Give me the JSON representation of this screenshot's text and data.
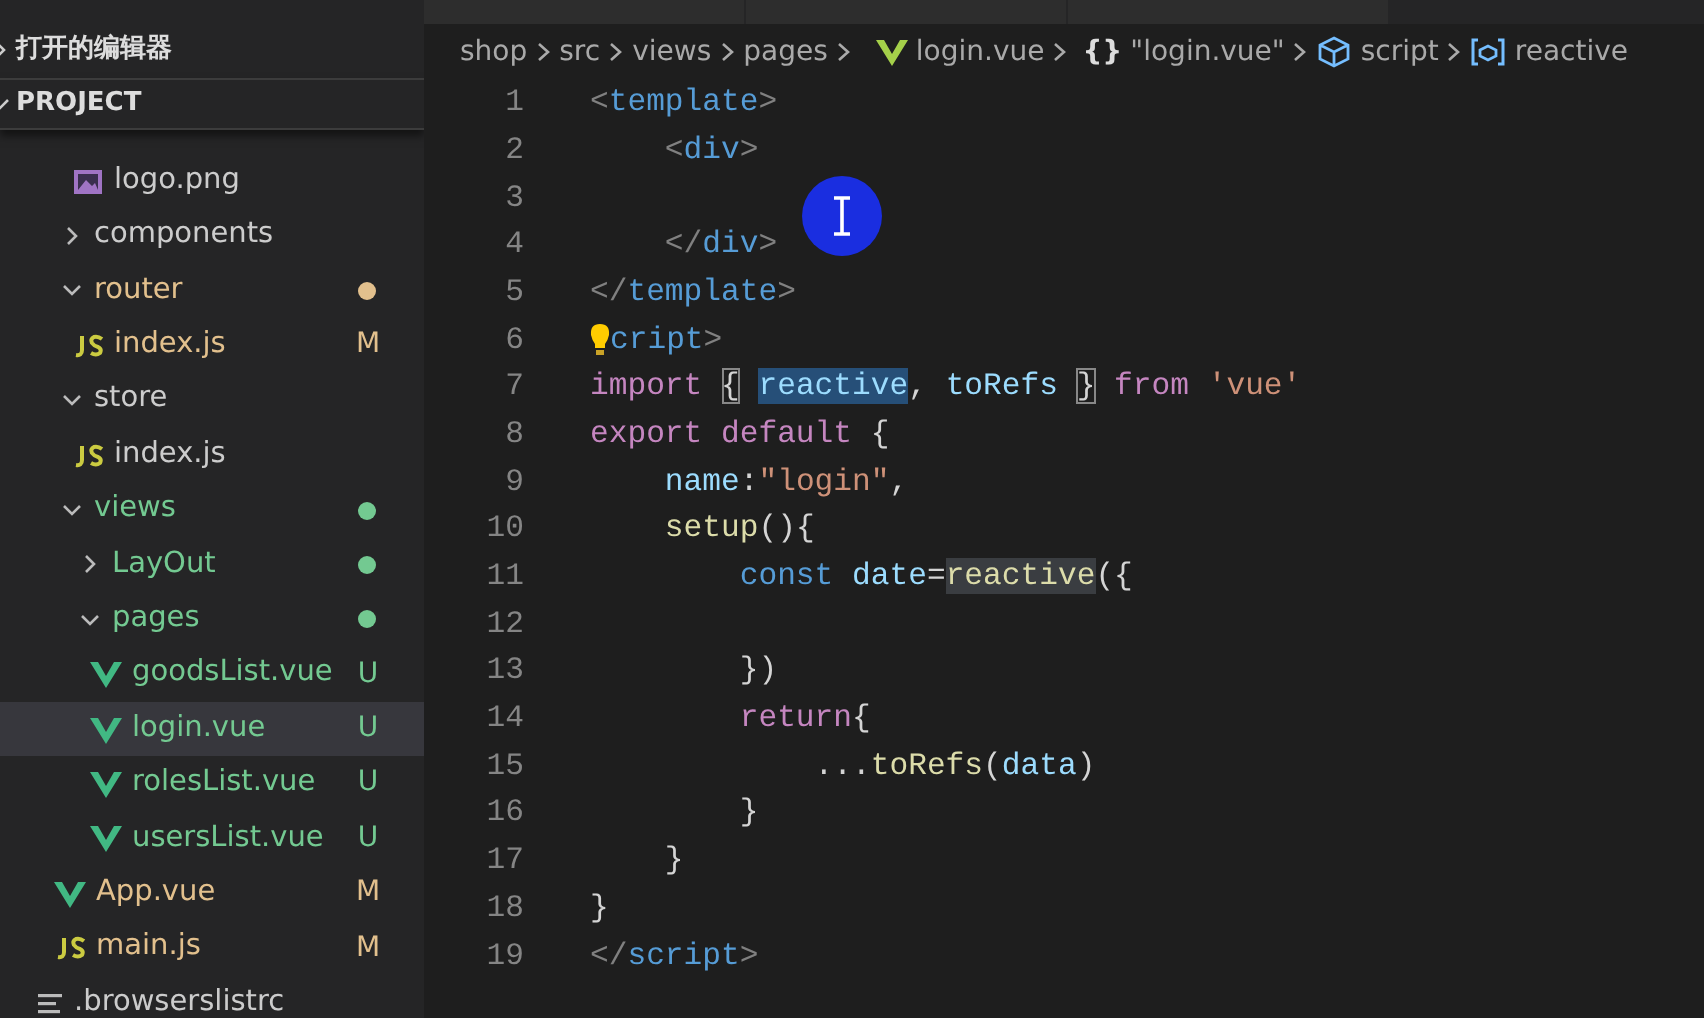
{
  "sidebar": {
    "sections": [
      {
        "title": "打开的编辑器",
        "expanded": false
      },
      {
        "title": "PROJECT",
        "expanded": true
      }
    ],
    "tree": [
      {
        "children": [
          {
            "children": [
              {
                "kind": "image",
                "name": "logo.png",
                "selected": false
              }
            ]
          },
          {
            "kind": "folder",
            "name": "components",
            "expanded": false,
            "selected": false
          },
          {
            "kind": "folder",
            "name": "router",
            "expanded": true,
            "color": "#e2c08d",
            "selected": false,
            "children": [
              {
                "kind": "js",
                "name": "index.js",
                "color": "#e2c08d",
                "status": "M",
                "selected": false
              }
            ]
          },
          {
            "kind": "folder",
            "name": "store",
            "expanded": true,
            "selected": false,
            "children": [
              {
                "kind": "js",
                "name": "index.js",
                "selected": false
              }
            ]
          },
          {
            "kind": "folder",
            "name": "views",
            "expanded": true,
            "color": "#73c991",
            "selected": false,
            "children": [
              {
                "kind": "folder",
                "name": "LayOut",
                "expanded": false,
                "color": "#73c991",
                "selected": false
              },
              {
                "kind": "folder",
                "name": "pages",
                "expanded": true,
                "color": "#73c991",
                "selected": false,
                "children": [
                  {
                    "kind": "vue",
                    "name": "goodsList.vue",
                    "color": "#73c991",
                    "status": "U",
                    "selected": false
                  },
                  {
                    "kind": "vue",
                    "name": "login.vue",
                    "color": "#73c991",
                    "status": "U",
                    "selected": true
                  },
                  {
                    "kind": "vue",
                    "name": "rolesList.vue",
                    "color": "#73c991",
                    "status": "U",
                    "selected": false
                  },
                  {
                    "kind": "vue",
                    "name": "usersList.vue",
                    "color": "#73c991",
                    "status": "U",
                    "selected": false
                  }
                ]
              }
            ]
          },
          {
            "kind": "vue",
            "name": "App.vue",
            "color": "#e2c08d",
            "status": "M",
            "selected": false
          },
          {
            "kind": "js",
            "name": "main.js",
            "color": "#e2c08d",
            "status": "M",
            "selected": false
          }
        ]
      },
      {
        "kind": "text",
        "name": ".browserslistrc",
        "selected": false
      }
    ]
  },
  "breadcrumbs": [
    {
      "kind": "folder",
      "label": "shop"
    },
    {
      "kind": "folder",
      "label": "src"
    },
    {
      "kind": "folder",
      "label": "views"
    },
    {
      "kind": "folder",
      "label": "pages"
    },
    {
      "kind": "vue",
      "label": "login.vue"
    },
    {
      "kind": "object",
      "glyph": "{}",
      "label": "\"login.vue\""
    },
    {
      "kind": "module",
      "label": "script"
    },
    {
      "kind": "variable",
      "label": "reactive"
    }
  ],
  "editor": {
    "pointer_highlight": true,
    "lines": [
      {
        "number": "1",
        "tokens": [
          {
            "text": "<",
            "kind": "punct"
          },
          {
            "text": "template",
            "kind": "tag"
          },
          {
            "text": ">",
            "kind": "punct"
          }
        ]
      },
      {
        "number": "2",
        "tokens": [
          {
            "text": "    <",
            "kind": "punct"
          },
          {
            "text": "div",
            "kind": "tag"
          },
          {
            "text": ">",
            "kind": "punct"
          }
        ]
      },
      {
        "number": "3"
      },
      {
        "number": "4",
        "tokens": [
          {
            "text": "    </",
            "kind": "punct"
          },
          {
            "text": "div",
            "kind": "tag"
          },
          {
            "text": ">",
            "kind": "punct"
          }
        ]
      },
      {
        "number": "5",
        "tokens": [
          {
            "text": "</",
            "kind": "punct"
          },
          {
            "text": "template",
            "kind": "tag"
          },
          {
            "text": ">",
            "kind": "punct"
          }
        ]
      },
      {
        "number": "6",
        "lightbulb": true,
        "tokens": [
          {
            "text": "cript",
            "kind": "tag"
          },
          {
            "text": ">",
            "kind": "punct"
          }
        ]
      },
      {
        "number": "7",
        "tokens": [
          {
            "text": "import ",
            "kind": "keyword"
          },
          {
            "text": "{",
            "kind": "plain",
            "matched": true
          },
          {
            "text": "reactive",
            "kind": "variable",
            "selected": true,
            "spaced": true
          },
          {
            "text": ", ",
            "kind": "plain"
          },
          {
            "text": "toRefs ",
            "kind": "variable"
          },
          {
            "text": "}",
            "kind": "plain",
            "matched": true
          },
          {
            "text": " from ",
            "kind": "keyword"
          },
          {
            "text": "'vue'",
            "kind": "string"
          }
        ]
      },
      {
        "number": "8",
        "tokens": [
          {
            "text": "export default",
            "kind": "keyword"
          },
          {
            "text": " {",
            "kind": "plain"
          }
        ]
      },
      {
        "number": "9",
        "tokens": [
          {
            "text": "    name",
            "kind": "variable"
          },
          {
            "text": ":",
            "kind": "plain"
          },
          {
            "text": "\"login\"",
            "kind": "string"
          },
          {
            "text": ",",
            "kind": "plain"
          }
        ]
      },
      {
        "number": "10",
        "tokens": [
          {
            "text": "    setup",
            "kind": "function"
          },
          {
            "text": "(){",
            "kind": "plain"
          }
        ]
      },
      {
        "number": "11",
        "tokens": [
          {
            "text": "        const ",
            "kind": "storage"
          },
          {
            "text": "date",
            "kind": "variable"
          },
          {
            "text": "=",
            "kind": "plain"
          },
          {
            "text": "reactive",
            "kind": "function",
            "highlighted": true
          },
          {
            "text": "({",
            "kind": "plain"
          }
        ]
      },
      {
        "number": "12"
      },
      {
        "number": "13",
        "tokens": [
          {
            "text": "        })",
            "kind": "plain"
          }
        ]
      },
      {
        "number": "14",
        "tokens": [
          {
            "text": "        return",
            "kind": "keyword"
          },
          {
            "text": "{",
            "kind": "plain"
          }
        ]
      },
      {
        "number": "15",
        "tokens": [
          {
            "text": "            ...",
            "kind": "plain"
          },
          {
            "text": "toRefs",
            "kind": "function"
          },
          {
            "text": "(",
            "kind": "plain"
          },
          {
            "text": "data",
            "kind": "variable"
          },
          {
            "text": ")",
            "kind": "plain"
          }
        ]
      },
      {
        "number": "16",
        "tokens": [
          {
            "text": "        }",
            "kind": "plain"
          }
        ]
      },
      {
        "number": "17",
        "tokens": [
          {
            "text": "    }",
            "kind": "plain"
          }
        ]
      },
      {
        "number": "18",
        "tokens": [
          {
            "text": "}",
            "kind": "plain"
          }
        ]
      },
      {
        "number": "19",
        "tokens": [
          {
            "text": "</",
            "kind": "punct"
          },
          {
            "text": "script",
            "kind": "tag"
          },
          {
            "text": ">",
            "kind": "punct"
          }
        ]
      }
    ]
  }
}
